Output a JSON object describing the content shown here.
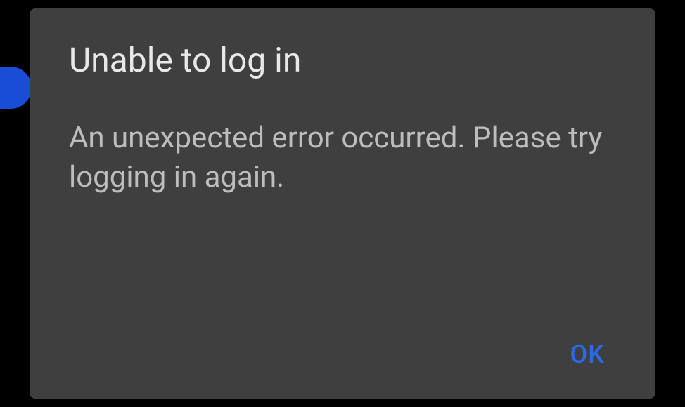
{
  "dialog": {
    "title": "Unable to log in",
    "message": "An unexpected error occurred. Please try logging in again.",
    "ok_label": "OK"
  }
}
